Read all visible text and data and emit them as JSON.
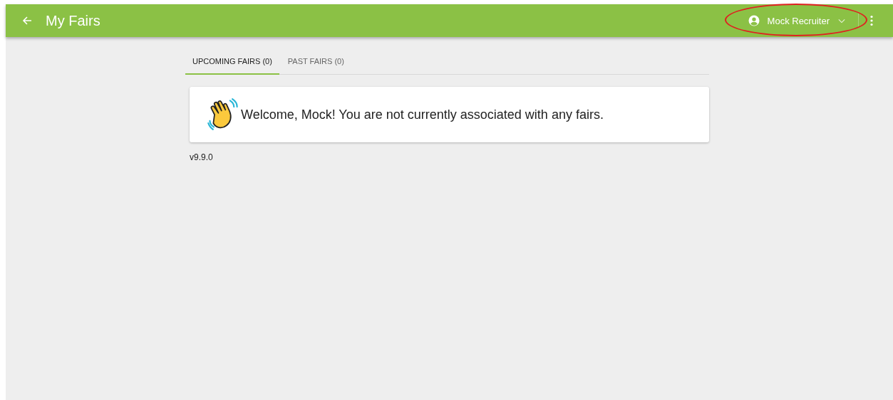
{
  "app_bar": {
    "title": "My Fairs",
    "user_menu": {
      "label": "Mock Recruiter",
      "highlighted": true
    }
  },
  "tabs": [
    {
      "label": "UPCOMING FAIRS (0)",
      "selected": true
    },
    {
      "label": "PAST FAIRS (0)",
      "selected": false
    }
  ],
  "welcome_message": "Welcome, Mock! You are not currently associated with any fairs.",
  "version": "v9.9.0"
}
